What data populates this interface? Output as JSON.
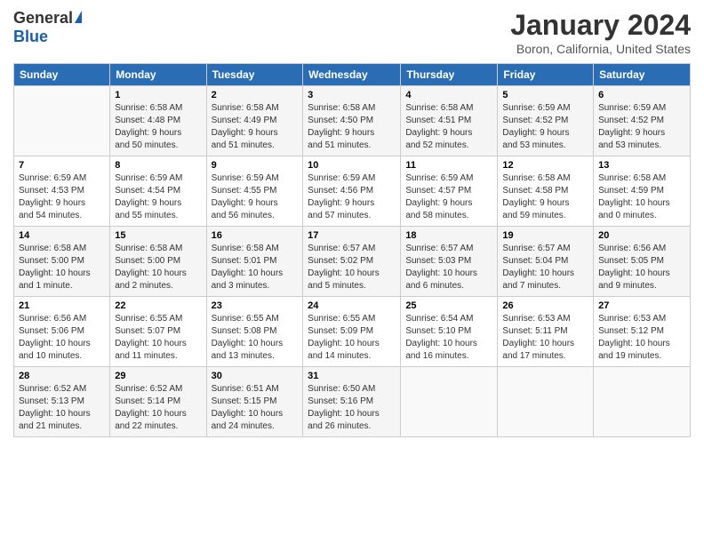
{
  "logo": {
    "general": "General",
    "blue": "Blue"
  },
  "title": "January 2024",
  "subtitle": "Boron, California, United States",
  "days_of_week": [
    "Sunday",
    "Monday",
    "Tuesday",
    "Wednesday",
    "Thursday",
    "Friday",
    "Saturday"
  ],
  "weeks": [
    [
      {
        "day": "",
        "info": ""
      },
      {
        "day": "1",
        "info": "Sunrise: 6:58 AM\nSunset: 4:48 PM\nDaylight: 9 hours\nand 50 minutes."
      },
      {
        "day": "2",
        "info": "Sunrise: 6:58 AM\nSunset: 4:49 PM\nDaylight: 9 hours\nand 51 minutes."
      },
      {
        "day": "3",
        "info": "Sunrise: 6:58 AM\nSunset: 4:50 PM\nDaylight: 9 hours\nand 51 minutes."
      },
      {
        "day": "4",
        "info": "Sunrise: 6:58 AM\nSunset: 4:51 PM\nDaylight: 9 hours\nand 52 minutes."
      },
      {
        "day": "5",
        "info": "Sunrise: 6:59 AM\nSunset: 4:52 PM\nDaylight: 9 hours\nand 53 minutes."
      },
      {
        "day": "6",
        "info": "Sunrise: 6:59 AM\nSunset: 4:52 PM\nDaylight: 9 hours\nand 53 minutes."
      }
    ],
    [
      {
        "day": "7",
        "info": "Sunrise: 6:59 AM\nSunset: 4:53 PM\nDaylight: 9 hours\nand 54 minutes."
      },
      {
        "day": "8",
        "info": "Sunrise: 6:59 AM\nSunset: 4:54 PM\nDaylight: 9 hours\nand 55 minutes."
      },
      {
        "day": "9",
        "info": "Sunrise: 6:59 AM\nSunset: 4:55 PM\nDaylight: 9 hours\nand 56 minutes."
      },
      {
        "day": "10",
        "info": "Sunrise: 6:59 AM\nSunset: 4:56 PM\nDaylight: 9 hours\nand 57 minutes."
      },
      {
        "day": "11",
        "info": "Sunrise: 6:59 AM\nSunset: 4:57 PM\nDaylight: 9 hours\nand 58 minutes."
      },
      {
        "day": "12",
        "info": "Sunrise: 6:58 AM\nSunset: 4:58 PM\nDaylight: 9 hours\nand 59 minutes."
      },
      {
        "day": "13",
        "info": "Sunrise: 6:58 AM\nSunset: 4:59 PM\nDaylight: 10 hours\nand 0 minutes."
      }
    ],
    [
      {
        "day": "14",
        "info": "Sunrise: 6:58 AM\nSunset: 5:00 PM\nDaylight: 10 hours\nand 1 minute."
      },
      {
        "day": "15",
        "info": "Sunrise: 6:58 AM\nSunset: 5:00 PM\nDaylight: 10 hours\nand 2 minutes."
      },
      {
        "day": "16",
        "info": "Sunrise: 6:58 AM\nSunset: 5:01 PM\nDaylight: 10 hours\nand 3 minutes."
      },
      {
        "day": "17",
        "info": "Sunrise: 6:57 AM\nSunset: 5:02 PM\nDaylight: 10 hours\nand 5 minutes."
      },
      {
        "day": "18",
        "info": "Sunrise: 6:57 AM\nSunset: 5:03 PM\nDaylight: 10 hours\nand 6 minutes."
      },
      {
        "day": "19",
        "info": "Sunrise: 6:57 AM\nSunset: 5:04 PM\nDaylight: 10 hours\nand 7 minutes."
      },
      {
        "day": "20",
        "info": "Sunrise: 6:56 AM\nSunset: 5:05 PM\nDaylight: 10 hours\nand 9 minutes."
      }
    ],
    [
      {
        "day": "21",
        "info": "Sunrise: 6:56 AM\nSunset: 5:06 PM\nDaylight: 10 hours\nand 10 minutes."
      },
      {
        "day": "22",
        "info": "Sunrise: 6:55 AM\nSunset: 5:07 PM\nDaylight: 10 hours\nand 11 minutes."
      },
      {
        "day": "23",
        "info": "Sunrise: 6:55 AM\nSunset: 5:08 PM\nDaylight: 10 hours\nand 13 minutes."
      },
      {
        "day": "24",
        "info": "Sunrise: 6:55 AM\nSunset: 5:09 PM\nDaylight: 10 hours\nand 14 minutes."
      },
      {
        "day": "25",
        "info": "Sunrise: 6:54 AM\nSunset: 5:10 PM\nDaylight: 10 hours\nand 16 minutes."
      },
      {
        "day": "26",
        "info": "Sunrise: 6:53 AM\nSunset: 5:11 PM\nDaylight: 10 hours\nand 17 minutes."
      },
      {
        "day": "27",
        "info": "Sunrise: 6:53 AM\nSunset: 5:12 PM\nDaylight: 10 hours\nand 19 minutes."
      }
    ],
    [
      {
        "day": "28",
        "info": "Sunrise: 6:52 AM\nSunset: 5:13 PM\nDaylight: 10 hours\nand 21 minutes."
      },
      {
        "day": "29",
        "info": "Sunrise: 6:52 AM\nSunset: 5:14 PM\nDaylight: 10 hours\nand 22 minutes."
      },
      {
        "day": "30",
        "info": "Sunrise: 6:51 AM\nSunset: 5:15 PM\nDaylight: 10 hours\nand 24 minutes."
      },
      {
        "day": "31",
        "info": "Sunrise: 6:50 AM\nSunset: 5:16 PM\nDaylight: 10 hours\nand 26 minutes."
      },
      {
        "day": "",
        "info": ""
      },
      {
        "day": "",
        "info": ""
      },
      {
        "day": "",
        "info": ""
      }
    ]
  ]
}
